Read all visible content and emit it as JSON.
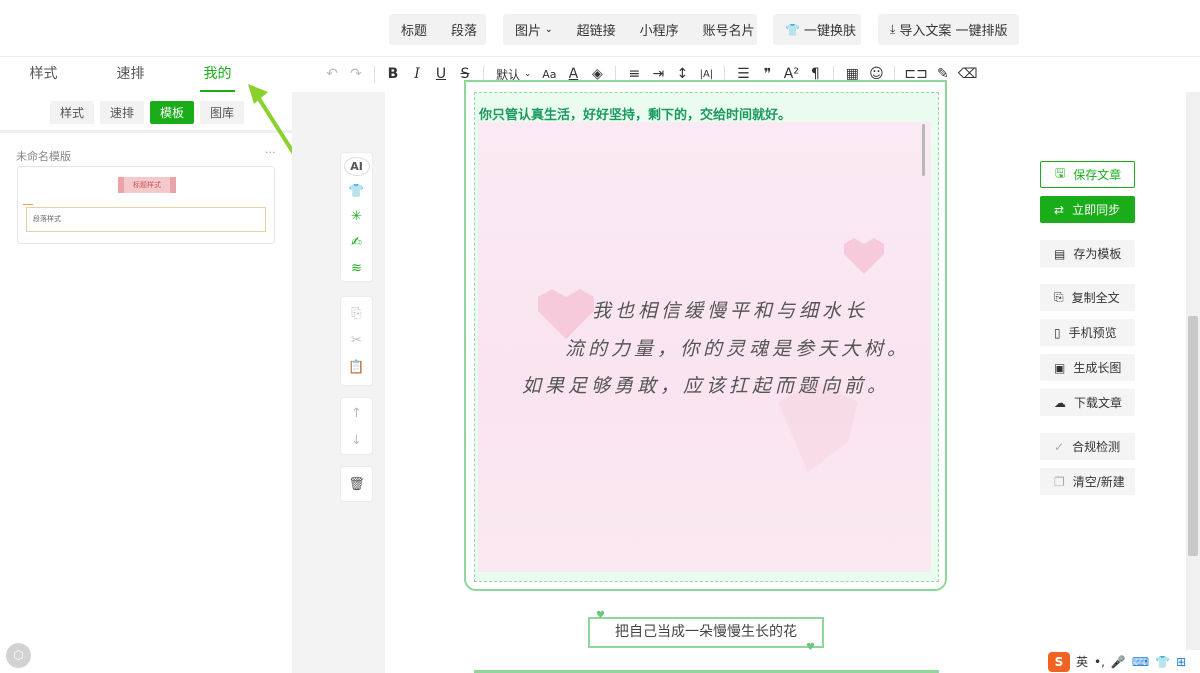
{
  "top_menu": {
    "group1": [
      "标题",
      "段落"
    ],
    "group2": [
      "图片",
      "超链接",
      "小程序",
      "账号名片"
    ],
    "theme_btn": "一键换肤",
    "import_btn": "导入文案 一键排版"
  },
  "left_tabs": [
    "样式",
    "速排",
    "我的"
  ],
  "toolbar": {
    "font_select": "默认",
    "buttons": [
      "undo-icon",
      "redo-icon",
      "bold-icon",
      "italic-icon",
      "underline-icon",
      "strikethrough-icon",
      "font-size-icon",
      "font-color-icon",
      "highlight-icon",
      "align-icon",
      "indent-icon",
      "line-height-icon",
      "letter-spacing-icon",
      "list-icon",
      "quote-icon",
      "superscript-icon",
      "paragraph-icon",
      "table-icon",
      "emoji-icon",
      "divider-icon",
      "format-brush-icon",
      "eraser-icon"
    ],
    "bold": "B",
    "italic": "I",
    "underline": "U",
    "strike": "S",
    "font_size": "Aa",
    "font_color": "A",
    "super": "A²",
    "para": "¶"
  },
  "sub_tabs": [
    "样式",
    "速排",
    "模板",
    "图库"
  ],
  "template": {
    "title": "未命名模版",
    "more": "···",
    "badge": "标题样式",
    "box": "段落样式"
  },
  "vertical_tools": {
    "ai": "AI"
  },
  "editor": {
    "headline": "你只管认真生活，好好坚持，剩下的，交给时间就好。",
    "poem": [
      "我也相信缓慢平和与细水长",
      "流的力量，你的灵魂是参天大树。",
      "如果足够勇敢，应该扛起而题向前。"
    ],
    "caption": "把自己当成一朵慢慢生长的花"
  },
  "right_buttons": [
    "保存文章",
    "立即同步",
    "存为模板",
    "复制全文",
    "手机预览",
    "生成长图",
    "下载文章",
    "合规检测",
    "清空/新建"
  ],
  "ime": {
    "logo": "S",
    "lang": "英"
  },
  "colors": {
    "accent": "#1aad19",
    "frame": "#8fd69a",
    "headline": "#1a9a5e"
  }
}
